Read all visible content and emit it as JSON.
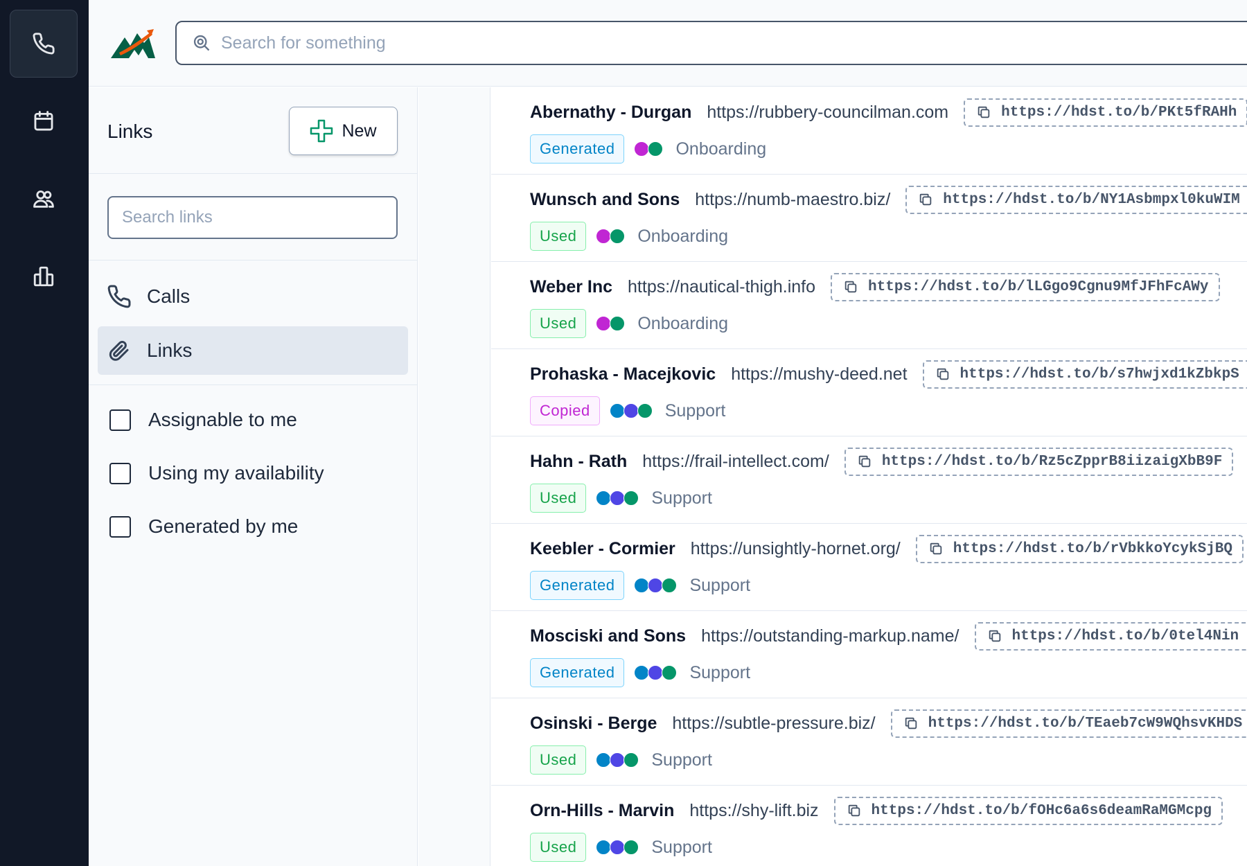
{
  "colors": {
    "rail_bg": "#111827",
    "accent_green": "#059669",
    "dot_magenta": "#c026d3",
    "dot_green": "#059669",
    "dot_blue": "#0284c7",
    "dot_indigo": "#4f46e5"
  },
  "rail": {
    "items": [
      {
        "icon": "phone-icon",
        "active": true
      },
      {
        "icon": "calendar-icon",
        "active": false
      },
      {
        "icon": "users-icon",
        "active": false
      },
      {
        "icon": "building-icon",
        "active": false
      }
    ]
  },
  "topbar": {
    "logo": "mountain-logo",
    "search_placeholder": "Search for something"
  },
  "sidebar": {
    "title": "Links",
    "new_label": "New",
    "search_placeholder": "Search links",
    "nav": [
      {
        "label": "Calls",
        "icon": "phone-icon",
        "active": false
      },
      {
        "label": "Links",
        "icon": "link-icon",
        "active": true
      }
    ],
    "filters": [
      {
        "label": "Assignable to me",
        "checked": false
      },
      {
        "label": "Using my availability",
        "checked": false
      },
      {
        "label": "Generated by me",
        "checked": false
      }
    ]
  },
  "links": [
    {
      "company": "Abernathy - Durgan",
      "url": "https://rubbery-councilman.com",
      "short": "https://hdst.to/b/PKt5fRAHh",
      "status": "Generated",
      "status_kind": "generated",
      "dots": [
        "#c026d3",
        "#059669"
      ],
      "team": "Onboarding"
    },
    {
      "company": "Wunsch and Sons",
      "url": "https://numb-maestro.biz/",
      "short": "https://hdst.to/b/NY1Asbmpxl0kuWIM",
      "status": "Used",
      "status_kind": "used",
      "dots": [
        "#c026d3",
        "#059669"
      ],
      "team": "Onboarding"
    },
    {
      "company": "Weber Inc",
      "url": "https://nautical-thigh.info",
      "short": "https://hdst.to/b/lLGgo9Cgnu9MfJFhFcAWy",
      "status": "Used",
      "status_kind": "used",
      "dots": [
        "#c026d3",
        "#059669"
      ],
      "team": "Onboarding"
    },
    {
      "company": "Prohaska - Macejkovic",
      "url": "https://mushy-deed.net",
      "short": "https://hdst.to/b/s7hwjxd1kZbkpS",
      "status": "Copied",
      "status_kind": "copied",
      "dots": [
        "#0284c7",
        "#4f46e5",
        "#059669"
      ],
      "team": "Support"
    },
    {
      "company": "Hahn - Rath",
      "url": "https://frail-intellect.com/",
      "short": "https://hdst.to/b/Rz5cZpprB8iizaigXbB9F",
      "status": "Used",
      "status_kind": "used",
      "dots": [
        "#0284c7",
        "#4f46e5",
        "#059669"
      ],
      "team": "Support"
    },
    {
      "company": "Keebler - Cormier",
      "url": "https://unsightly-hornet.org/",
      "short": "https://hdst.to/b/rVbkkoYcykSjBQ",
      "status": "Generated",
      "status_kind": "generated",
      "dots": [
        "#0284c7",
        "#4f46e5",
        "#059669"
      ],
      "team": "Support"
    },
    {
      "company": "Mosciski and Sons",
      "url": "https://outstanding-markup.name/",
      "short": "https://hdst.to/b/0tel4Nin",
      "status": "Generated",
      "status_kind": "generated",
      "dots": [
        "#0284c7",
        "#4f46e5",
        "#059669"
      ],
      "team": "Support"
    },
    {
      "company": "Osinski - Berge",
      "url": "https://subtle-pressure.biz/",
      "short": "https://hdst.to/b/TEaeb7cW9WQhsvKHDS",
      "status": "Used",
      "status_kind": "used",
      "dots": [
        "#0284c7",
        "#4f46e5",
        "#059669"
      ],
      "team": "Support"
    },
    {
      "company": "Orn-Hills - Marvin",
      "url": "https://shy-lift.biz",
      "short": "https://hdst.to/b/fOHc6a6s6deamRaMGMcpg",
      "status": "Used",
      "status_kind": "used",
      "dots": [
        "#0284c7",
        "#4f46e5",
        "#059669"
      ],
      "team": "Support"
    }
  ]
}
